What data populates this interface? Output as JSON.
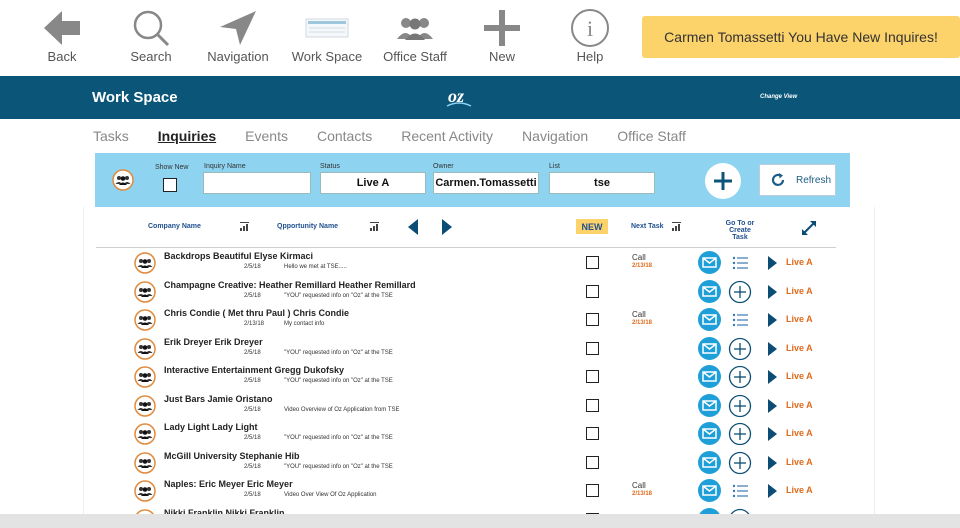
{
  "toolbar": {
    "back": "Back",
    "search": "Search",
    "navigation": "Navigation",
    "workspace": "Work Space",
    "office_staff": "Office Staff",
    "new": "New",
    "help": "Help",
    "notice": "Carmen Tomassetti You Have New Inquires!"
  },
  "header": {
    "title": "Work Space",
    "change_view": "Change View"
  },
  "tabs": [
    "Tasks",
    "Inquiries",
    "Events",
    "Contacts",
    "Recent Activity",
    "Navigation",
    "Office Staff"
  ],
  "active_tab": "Inquiries",
  "filter": {
    "show_new_label": "Show New",
    "inquiry_name_label": "Inquiry Name",
    "inquiry_name_value": "",
    "status_label": "Status",
    "status_value": "Live A",
    "owner_label": "Owner",
    "owner_value": "Carmen.Tomassetti",
    "list_label": "List",
    "list_value": "tse",
    "refresh_label": "Refresh"
  },
  "table_header": {
    "company_name": "Company Name",
    "opportunity_name": "Qpportunity Name",
    "new_badge": "NEW",
    "next_task": "Next Task",
    "goto_line1": "Go To or",
    "goto_line2": "Create Task"
  },
  "rows": [
    {
      "name": "Backdrops Beautiful  Elyse Kirmaci",
      "date": "2/5/18",
      "note": "Hello we met at TSE.....",
      "task": "Call",
      "task_date": "2/13/18",
      "second": "list",
      "status": "Live A"
    },
    {
      "name": "Champagne Creative: Heather Remillard  Heather Remillard",
      "date": "2/5/18",
      "note": "\"YOU\" requested info on \"Oz\" at the TSE",
      "task": "",
      "task_date": "",
      "second": "plus",
      "status": "Live A"
    },
    {
      "name": "Chris Condie ( Met thru Paul )  Chris Condie",
      "date": "2/13/18",
      "note": "My contact info",
      "task": "Call",
      "task_date": "2/13/18",
      "second": "list",
      "status": "Live A"
    },
    {
      "name": "Erik Dreyer  Erik Dreyer",
      "date": "2/5/18",
      "note": "\"YOU\" requested info on \"Oz\" at the TSE",
      "task": "",
      "task_date": "",
      "second": "plus",
      "status": "Live A"
    },
    {
      "name": "Interactive Entertainment  Gregg Dukofsky",
      "date": "2/5/18",
      "note": "\"YOU\" requested info on \"Oz\" at the TSE",
      "task": "",
      "task_date": "",
      "second": "plus",
      "status": "Live A"
    },
    {
      "name": "Just Bars  Jamie Oristano",
      "date": "2/5/18",
      "note": "Video Overview of Oz Application from TSE",
      "task": "",
      "task_date": "",
      "second": "plus",
      "status": "Live A"
    },
    {
      "name": "Lady Light  Lady Light",
      "date": "2/5/18",
      "note": "\"YOU\" requested info on \"Oz\" at the TSE",
      "task": "",
      "task_date": "",
      "second": "plus",
      "status": "Live A"
    },
    {
      "name": "McGill University  Stephanie Hib",
      "date": "2/5/18",
      "note": "\"YOU\" requested info on \"Oz\" at the TSE",
      "task": "",
      "task_date": "",
      "second": "plus",
      "status": "Live A"
    },
    {
      "name": "Naples: Eric Meyer  Eric Meyer",
      "date": "2/5/18",
      "note": "Video Over View Of Oz Application",
      "task": "Call",
      "task_date": "2/13/18",
      "second": "list",
      "status": "Live A"
    },
    {
      "name": "Nikki Franklin  Nikki Franklin",
      "date": "",
      "note": "",
      "task": "",
      "task_date": "",
      "second": "plus",
      "status": ""
    }
  ],
  "colors": {
    "header_blue": "#0b5579",
    "filter_blue": "#8ed3f0",
    "notice_yellow": "#fcd26a",
    "status_orange": "#e06a1c",
    "mail_blue": "#1e9fd8"
  }
}
